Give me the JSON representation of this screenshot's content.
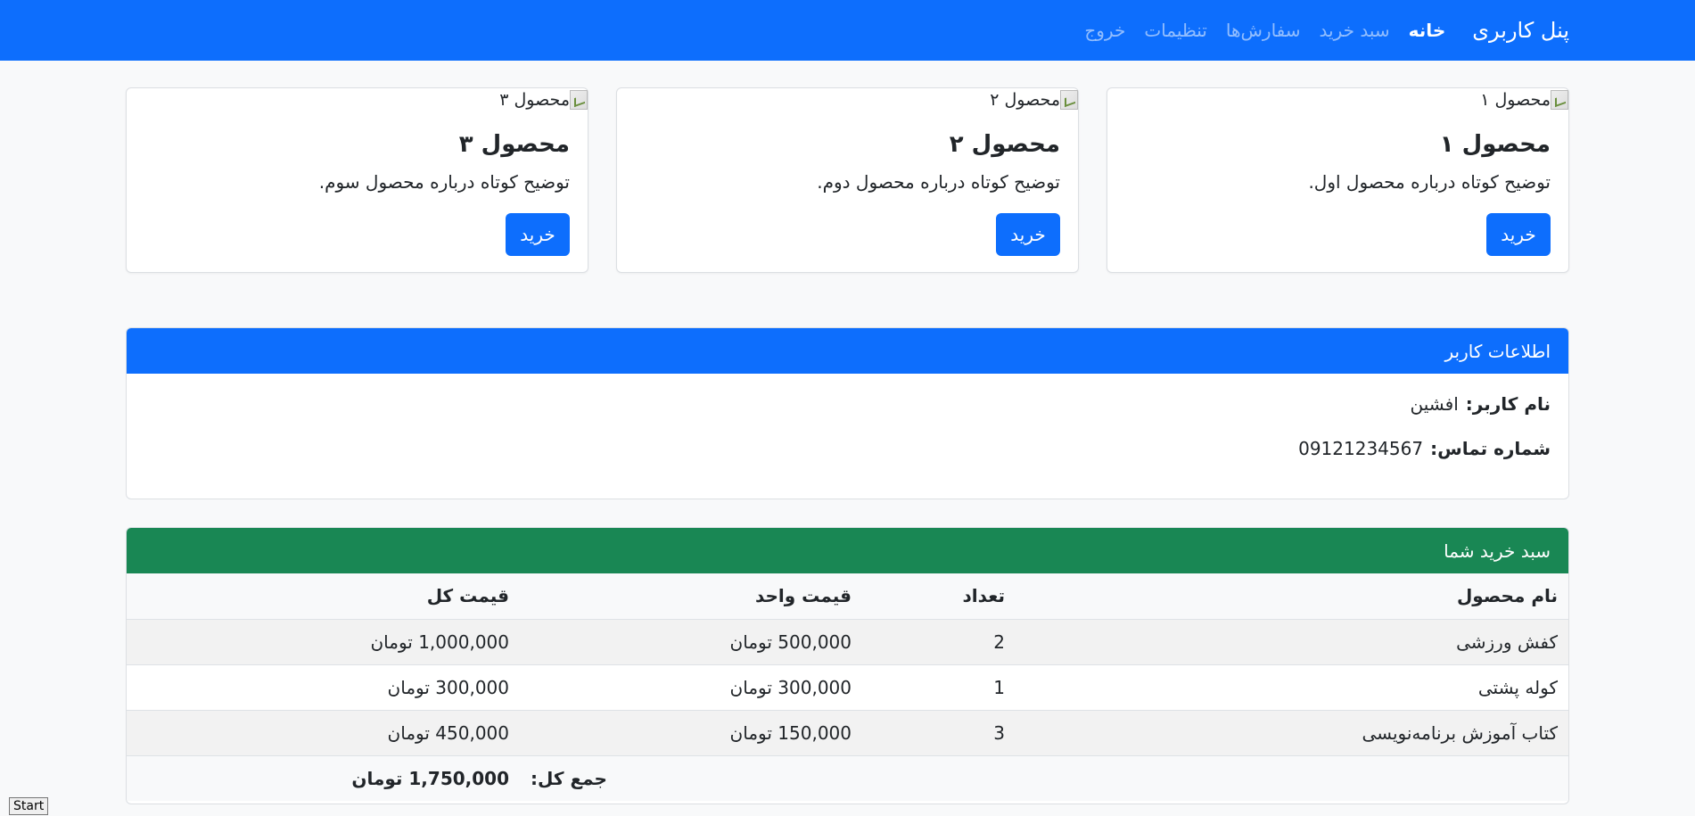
{
  "navbar": {
    "brand": "پنل کاربری",
    "links": [
      {
        "label": "خانه",
        "active": true
      },
      {
        "label": "سبد خرید",
        "active": false
      },
      {
        "label": "سفارش‌ها",
        "active": false
      },
      {
        "label": "تنظیمات",
        "active": false
      },
      {
        "label": "خروج",
        "active": false
      }
    ]
  },
  "products": [
    {
      "img_alt": "محصول ۱",
      "title": "محصول ۱",
      "text": "توضیح کوتاه درباره محصول اول.",
      "button": "خرید"
    },
    {
      "img_alt": "محصول ۲",
      "title": "محصول ۲",
      "text": "توضیح کوتاه درباره محصول دوم.",
      "button": "خرید"
    },
    {
      "img_alt": "محصول ۳",
      "title": "محصول ۳",
      "text": "توضیح کوتاه درباره محصول سوم.",
      "button": "خرید"
    }
  ],
  "user_info": {
    "header": "اطلاعات کاربر",
    "username_label": "نام کاربر:",
    "username": "افشین",
    "phone_label": "شماره تماس:",
    "phone": "09121234567"
  },
  "cart": {
    "header": "سبد خرید شما",
    "columns": [
      "نام محصول",
      "تعداد",
      "قیمت واحد",
      "قیمت کل"
    ],
    "rows": [
      [
        "کفش ورزشی",
        "2",
        "500,000 تومان",
        "1,000,000 تومان"
      ],
      [
        "کوله پشتی",
        "1",
        "300,000 تومان",
        "300,000 تومان"
      ],
      [
        "کتاب آموزش برنامه‌نویسی",
        "3",
        "150,000 تومان",
        "450,000 تومان"
      ]
    ],
    "total_label": "جمع کل:",
    "total_value": "1,750,000 تومان"
  },
  "start_button": "Start",
  "colors": {
    "primary": "#0d6efd",
    "success": "#198754",
    "background": "#f8f9fa"
  }
}
